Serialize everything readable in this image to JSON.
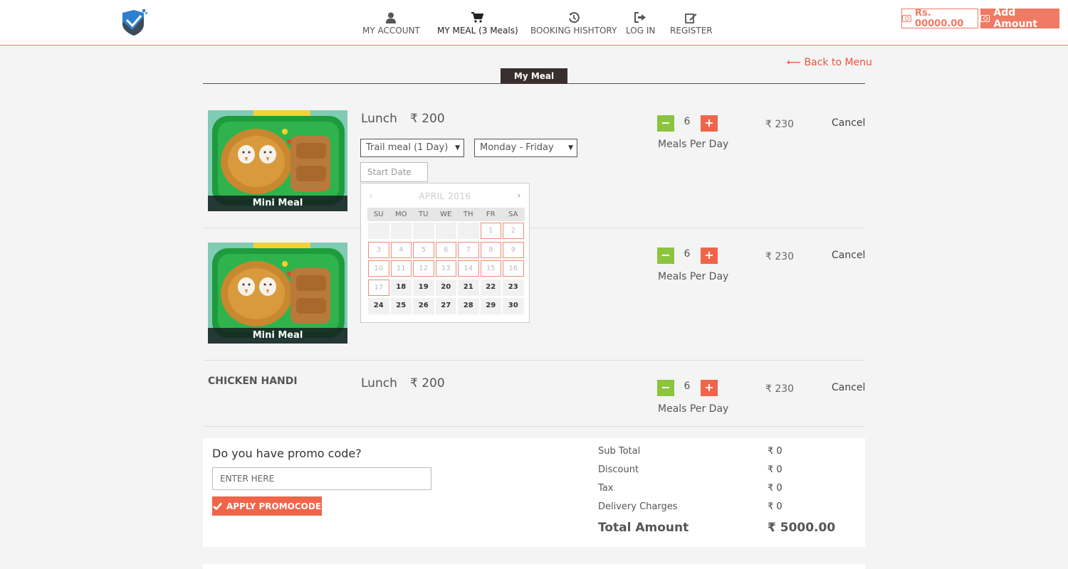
{
  "header": {
    "nav": [
      {
        "label": "MY ACCOUNT",
        "icon": "user-icon"
      },
      {
        "label": "MY MEAL (3 Meals)",
        "icon": "cart-icon"
      },
      {
        "label": "BOOKING HISHTORY",
        "icon": "history-icon"
      },
      {
        "label": "LOG IN",
        "icon": "sign-in-icon"
      },
      {
        "label": "REGISTER",
        "icon": "edit-icon"
      }
    ],
    "wallet_balance": "Rs. 00000.00",
    "add_amount_label": "Add Amount"
  },
  "page": {
    "back_link": "⟵ Back to Menu",
    "title": "My Meal"
  },
  "meals": [
    {
      "image_caption": "Mini Meal",
      "type": "Lunch",
      "price": "₹ 200",
      "plan": "Trail meal (1 Day)",
      "days": "Monday - Friday",
      "start_date_placeholder": "Start Date",
      "quantity": "6",
      "quantity_label": "Meals Per Day",
      "line_total": "₹ 230",
      "cancel_label": "Cancel"
    },
    {
      "image_caption": "Mini Meal",
      "type": "",
      "price": "",
      "quantity": "6",
      "quantity_label": "Meals Per Day",
      "line_total": "₹ 230",
      "cancel_label": "Cancel"
    },
    {
      "name": "CHICKEN HANDI",
      "type": "Lunch",
      "price": "₹ 200",
      "quantity": "6",
      "quantity_label": "Meals Per Day",
      "line_total": "₹ 230",
      "cancel_label": "Cancel"
    }
  ],
  "calendar": {
    "month": "APRIL 2016",
    "prev": "‹",
    "next": "›",
    "weekdays": [
      "SU",
      "MO",
      "TU",
      "WE",
      "TH",
      "FR",
      "SA"
    ],
    "weeks": [
      [
        "",
        "",
        "",
        "",
        "",
        "1",
        "2"
      ],
      [
        "3",
        "4",
        "5",
        "6",
        "7",
        "8",
        "9"
      ],
      [
        "10",
        "11",
        "12",
        "13",
        "14",
        "15",
        "16"
      ],
      [
        "17",
        "18",
        "19",
        "20",
        "21",
        "22",
        "23"
      ],
      [
        "24",
        "25",
        "26",
        "27",
        "28",
        "29",
        "30"
      ]
    ],
    "first_enabled_day": 18
  },
  "promo": {
    "title": "Do you have promo code?",
    "placeholder": "ENTER HERE",
    "button_label": "APPLY PROMOCODE"
  },
  "summary": {
    "rows": [
      {
        "label": "Sub Total",
        "value": "₹ 0"
      },
      {
        "label": "Discount",
        "value": "₹ 0"
      },
      {
        "label": "Tax",
        "value": "₹ 0"
      },
      {
        "label": "Delivery Charges",
        "value": "₹ 0"
      }
    ],
    "total_label": "Total Amount",
    "total_value": "₹ 5000.00"
  },
  "colors": {
    "accent": "#f0654a",
    "minus_button": "#8cc43f",
    "title_tab": "#3a2f2f",
    "link": "#e8553a"
  }
}
